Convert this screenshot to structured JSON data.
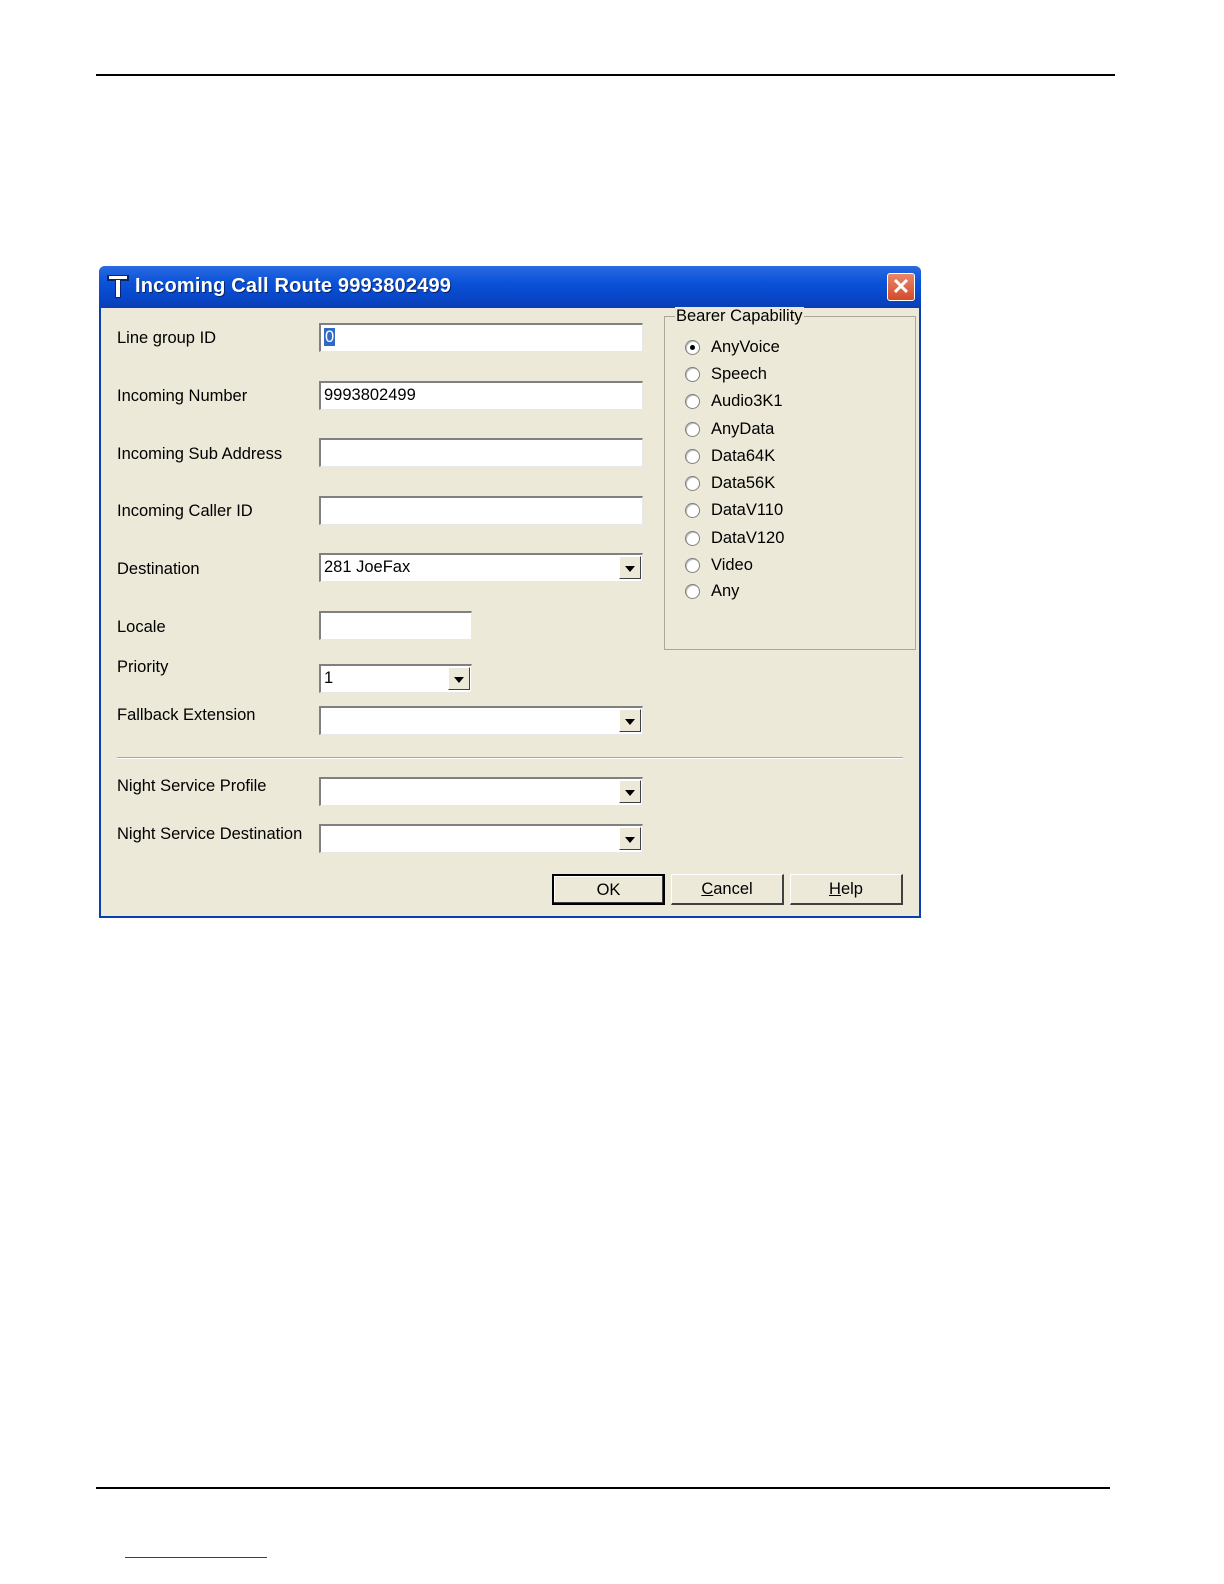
{
  "dialog": {
    "title": "Incoming Call Route 9993802499",
    "close_label": "✕"
  },
  "fields": {
    "line_group_id": {
      "label": "Line group ID",
      "value": "0"
    },
    "incoming_number": {
      "label": "Incoming Number",
      "value": "9993802499"
    },
    "incoming_sub_address": {
      "label": "Incoming Sub Address",
      "value": ""
    },
    "incoming_caller_id": {
      "label": "Incoming Caller ID",
      "value": ""
    },
    "destination": {
      "label": "Destination",
      "value": "281  JoeFax"
    },
    "locale": {
      "label": "Locale",
      "value": ""
    },
    "priority": {
      "label": "Priority",
      "value": "1"
    },
    "fallback_extension": {
      "label": "Fallback Extension",
      "value": ""
    },
    "night_service_profile": {
      "label": "Night Service Profile",
      "value": ""
    },
    "night_service_destination": {
      "label": "Night Service Destination",
      "value": ""
    }
  },
  "bearer": {
    "title": "Bearer Capability",
    "selected": "AnyVoice",
    "options": [
      "AnyVoice",
      "Speech",
      "Audio3K1",
      "AnyData",
      "Data64K",
      "Data56K",
      "DataV110",
      "DataV120",
      "Video",
      "Any"
    ]
  },
  "buttons": {
    "ok": "OK",
    "cancel_first": "C",
    "cancel_rest": "ancel",
    "help_first": "H",
    "help_rest": "elp"
  },
  "colors": {
    "titlebar": "#0a52d8",
    "dialog_bg": "#ece9d8",
    "selection": "#316ac5",
    "close": "#d4492b"
  }
}
